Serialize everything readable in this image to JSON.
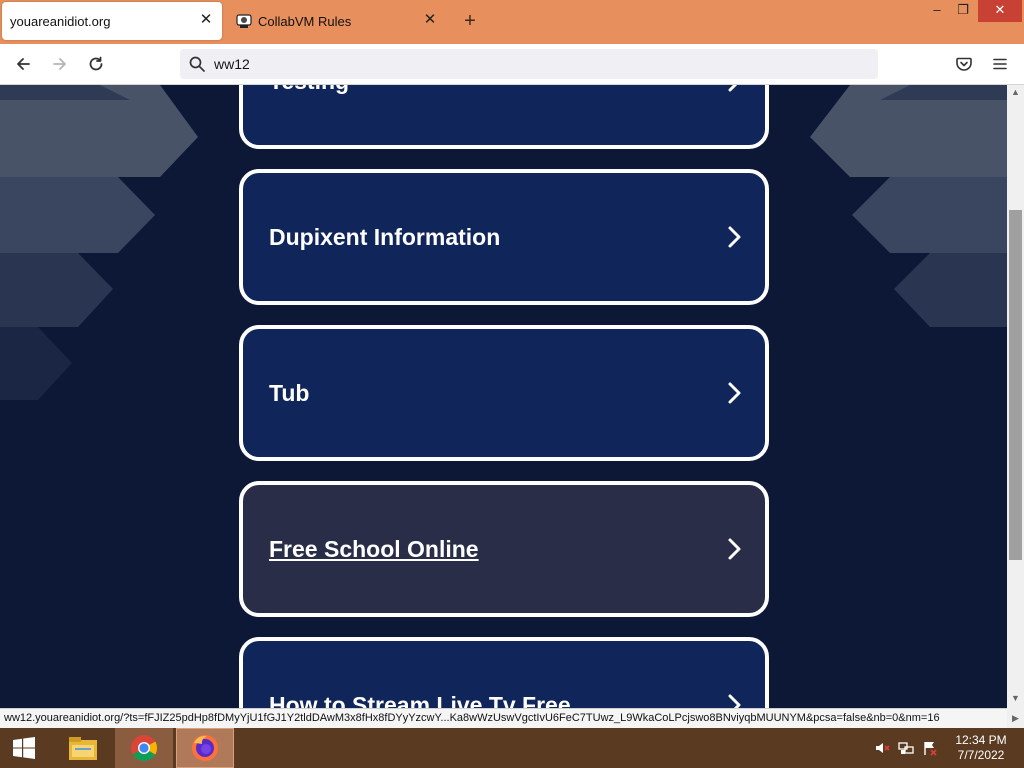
{
  "browser": {
    "tabs": [
      {
        "title": "youareanidiot.org",
        "active": true
      },
      {
        "title": "CollabVM Rules",
        "active": false
      }
    ],
    "new_tab_symbol": "+",
    "window_controls": {
      "minimize": "–",
      "maximize": "❐",
      "close": "✕"
    },
    "url_value": "ww12",
    "nav_icons": [
      "back-arrow-icon",
      "forward-arrow-icon",
      "reload-icon",
      "search-icon",
      "pocket-icon",
      "hamburger-menu-icon"
    ]
  },
  "page": {
    "cards": [
      {
        "label": "Testing",
        "hover": false
      },
      {
        "label": "Dupixent Information",
        "hover": false
      },
      {
        "label": "Tub",
        "hover": false
      },
      {
        "label": "Free School Online",
        "hover": true
      },
      {
        "label": "How to Stream Live Tv Free",
        "hover": false
      }
    ],
    "colors": {
      "background": "#0c1836",
      "card": "#10255a",
      "card_hover": "#292d47",
      "card_border": "#ffffff"
    }
  },
  "status_url": "ww12.youareanidiot.org/?ts=fFJIZ25pdHp8fDMyYjU1fGJ1Y2tldDAwM3x8fHx8fDYyYzcwY...Ka8wWzUswVgctIvU6FeC7TUwz_L9WkaCoLPcjswo8BNviyqbMUUNYM&pcsa=false&nb=0&nm=16",
  "taskbar": {
    "items": [
      "windows-start-icon",
      "file-explorer-icon",
      "chrome-icon",
      "firefox-icon"
    ],
    "time": "12:34 PM",
    "date": "7/7/2022"
  }
}
